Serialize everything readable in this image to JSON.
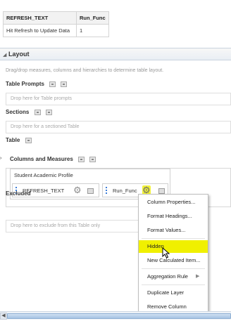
{
  "preview": {
    "headers": [
      "REFRESH_TEXT",
      "Run_Func"
    ],
    "row": [
      "Hit Refresh to Update Data",
      "1"
    ]
  },
  "layout": {
    "title": "Layout",
    "instruction": "Drag/drop measures, columns and hierarchies to determine table layout.",
    "table_prompts_label": "Table Prompts",
    "table_prompts_drop": "Drop here for Table prompts",
    "sections_label": "Sections",
    "sections_drop": "Drop here for a sectioned Table",
    "table_label": "Table",
    "columns_measures_label": "Columns and Measures",
    "profile_title": "Student Academic Profile",
    "columns": [
      "REFRESH_TEXT",
      "Run_Func"
    ],
    "excluded_label": "Excluded",
    "excluded_drop": "Drop here to exclude from this Table only"
  },
  "context_menu": {
    "items": [
      "Column Properties...",
      "Format Headings...",
      "Format Values...",
      "Hidden",
      "New Calculated Item...",
      "Aggregation Rule",
      "Duplicate Layer",
      "Remove Column"
    ],
    "highlighted": "Hidden"
  },
  "icons": {
    "gear": "gear-icon",
    "collapse": "collapse-triangle-icon",
    "properties": "properties-icon",
    "cursor": "mouse-pointer-icon"
  },
  "colors": {
    "highlight": "#f0f000",
    "drag_handle": "#3b7dd8",
    "scrollbar": "#a6c3e2"
  }
}
